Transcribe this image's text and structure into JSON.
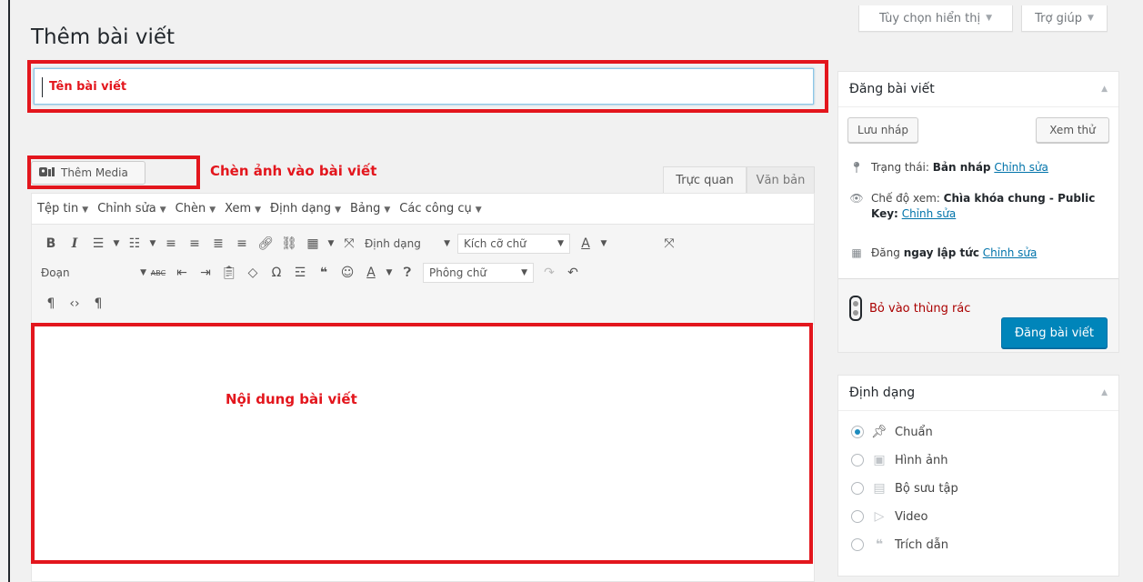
{
  "header": {
    "screen_options": "Tùy chọn hiển thị",
    "help": "Trợ giúp",
    "page_title": "Thêm bài viết"
  },
  "title_field": {
    "placeholder": "Tên bài viết"
  },
  "annotations": {
    "media": "Chèn ảnh vào bài viết",
    "content": "Nội dung bài viết"
  },
  "editor": {
    "add_media": "Thêm Media",
    "tabs": [
      "Trực quan",
      "Văn bản"
    ],
    "menu": [
      "Tệp tin",
      "Chỉnh sửa",
      "Chèn",
      "Xem",
      "Định dạng",
      "Bảng",
      "Các công cụ"
    ],
    "toolbar": {
      "format_dropdown": "Định dạng",
      "font_size": "Kích cỡ chữ",
      "paragraph": "Đoạn",
      "font_family": "Phông chữ"
    }
  },
  "publish_box": {
    "title": "Đăng bài viết",
    "save_draft": "Lưu nháp",
    "preview": "Xem thử",
    "status_label": "Trạng thái:",
    "status_value": "Bản nháp",
    "visibility_label": "Chế độ xem:",
    "visibility_value": "Chìa khóa chung - Public Key:",
    "publish_label": "Đăng",
    "publish_value": "ngay lập tức",
    "edit_link": "Chỉnh sửa",
    "trash": "Bỏ vào thùng rác",
    "publish_button": "Đăng bài viết"
  },
  "format_box": {
    "title": "Định dạng",
    "options": [
      "Chuẩn",
      "Hình ảnh",
      "Bộ sưu tập",
      "Video",
      "Trích dẫn"
    ],
    "selected": "Chuẩn"
  }
}
